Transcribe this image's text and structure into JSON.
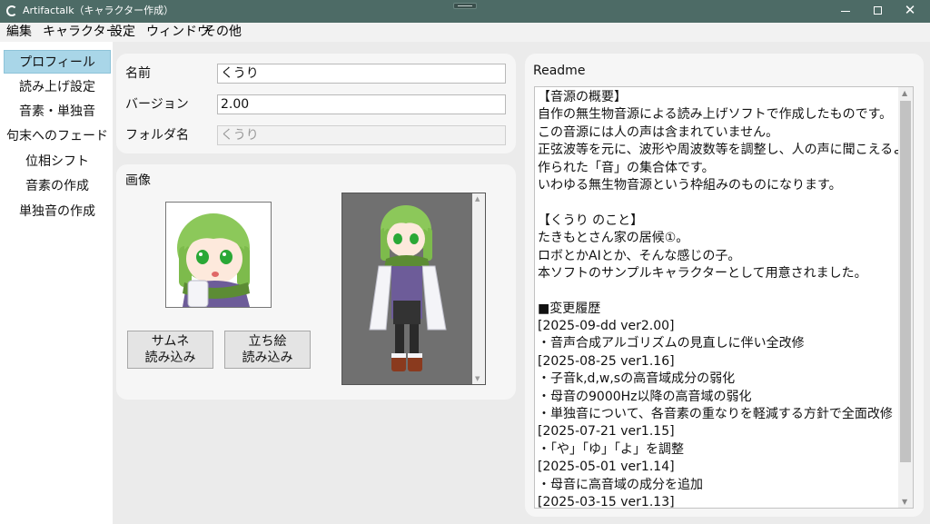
{
  "window": {
    "title": "Artifactalk（キャラクター作成）",
    "minimize_icon": "minimize-icon",
    "maximize_icon": "maximize-icon",
    "close_icon": "close-icon",
    "close_glyph": "✕"
  },
  "menu": {
    "edit": "編集",
    "character": "キャラクター",
    "settings": "設定",
    "window": "ウィンドウ",
    "other": "その他"
  },
  "sidebar": {
    "items": [
      {
        "label": "プロフィール",
        "selected": true
      },
      {
        "label": "読み上げ設定"
      },
      {
        "label": "音素・単独音"
      },
      {
        "label": "句末へのフェード"
      },
      {
        "label": "位相シフト"
      },
      {
        "label": "音素の作成"
      },
      {
        "label": "単独音の作成"
      }
    ],
    "selected_color": "#a9d6e8"
  },
  "profile": {
    "name_label": "名前",
    "name_value": "くうり",
    "version_label": "バージョン",
    "version_value": "2.00",
    "folder_label": "フォルダ名",
    "folder_value": "くうり"
  },
  "image": {
    "section_label": "画像",
    "thumbnail_button_line1": "サムネ",
    "thumbnail_button_line2": "読み込み",
    "standing_button_line1": "立ち絵",
    "standing_button_line2": "読み込み"
  },
  "readme": {
    "title": "Readme",
    "lines": [
      "【音源の概要】",
      "自作の無生物音源による読み上げソフトで作成したものです。",
      "この音源には人の声は含まれていません。",
      "正弦波等を元に、波形や周波数等を調整し、人の声に聞こえるように",
      "作られた「音」の集合体です。",
      "いわゆる無生物音源という枠組みのものになります。",
      "",
      "【くうり のこと】",
      "たきもとさん家の居候①。",
      "ロボとかAIとか、そんな感じの子。",
      "本ソフトのサンプルキャラクターとして用意されました。",
      "",
      "■変更履歴",
      "[2025-09-dd ver2.00]",
      "・音声合成アルゴリズムの見直しに伴い全改修",
      "[2025-08-25 ver1.16]",
      "・子音k,d,w,sの高音域成分の弱化",
      "・母音の9000Hz以降の高音域の弱化",
      "・単独音について、各音素の重なりを軽減する方針で全面改修",
      "[2025-07-21 ver1.15]",
      "・「や」「ゆ」「よ」を調整",
      "[2025-05-01 ver1.14]",
      "・母音に高音域の成分を追加",
      "[2025-03-15 ver1.13]"
    ]
  },
  "colors": {
    "titlebar": "#4d6b66",
    "character_hair": "#8cc85a",
    "character_eyes": "#2aa836",
    "scarf": "#5c8c34"
  }
}
